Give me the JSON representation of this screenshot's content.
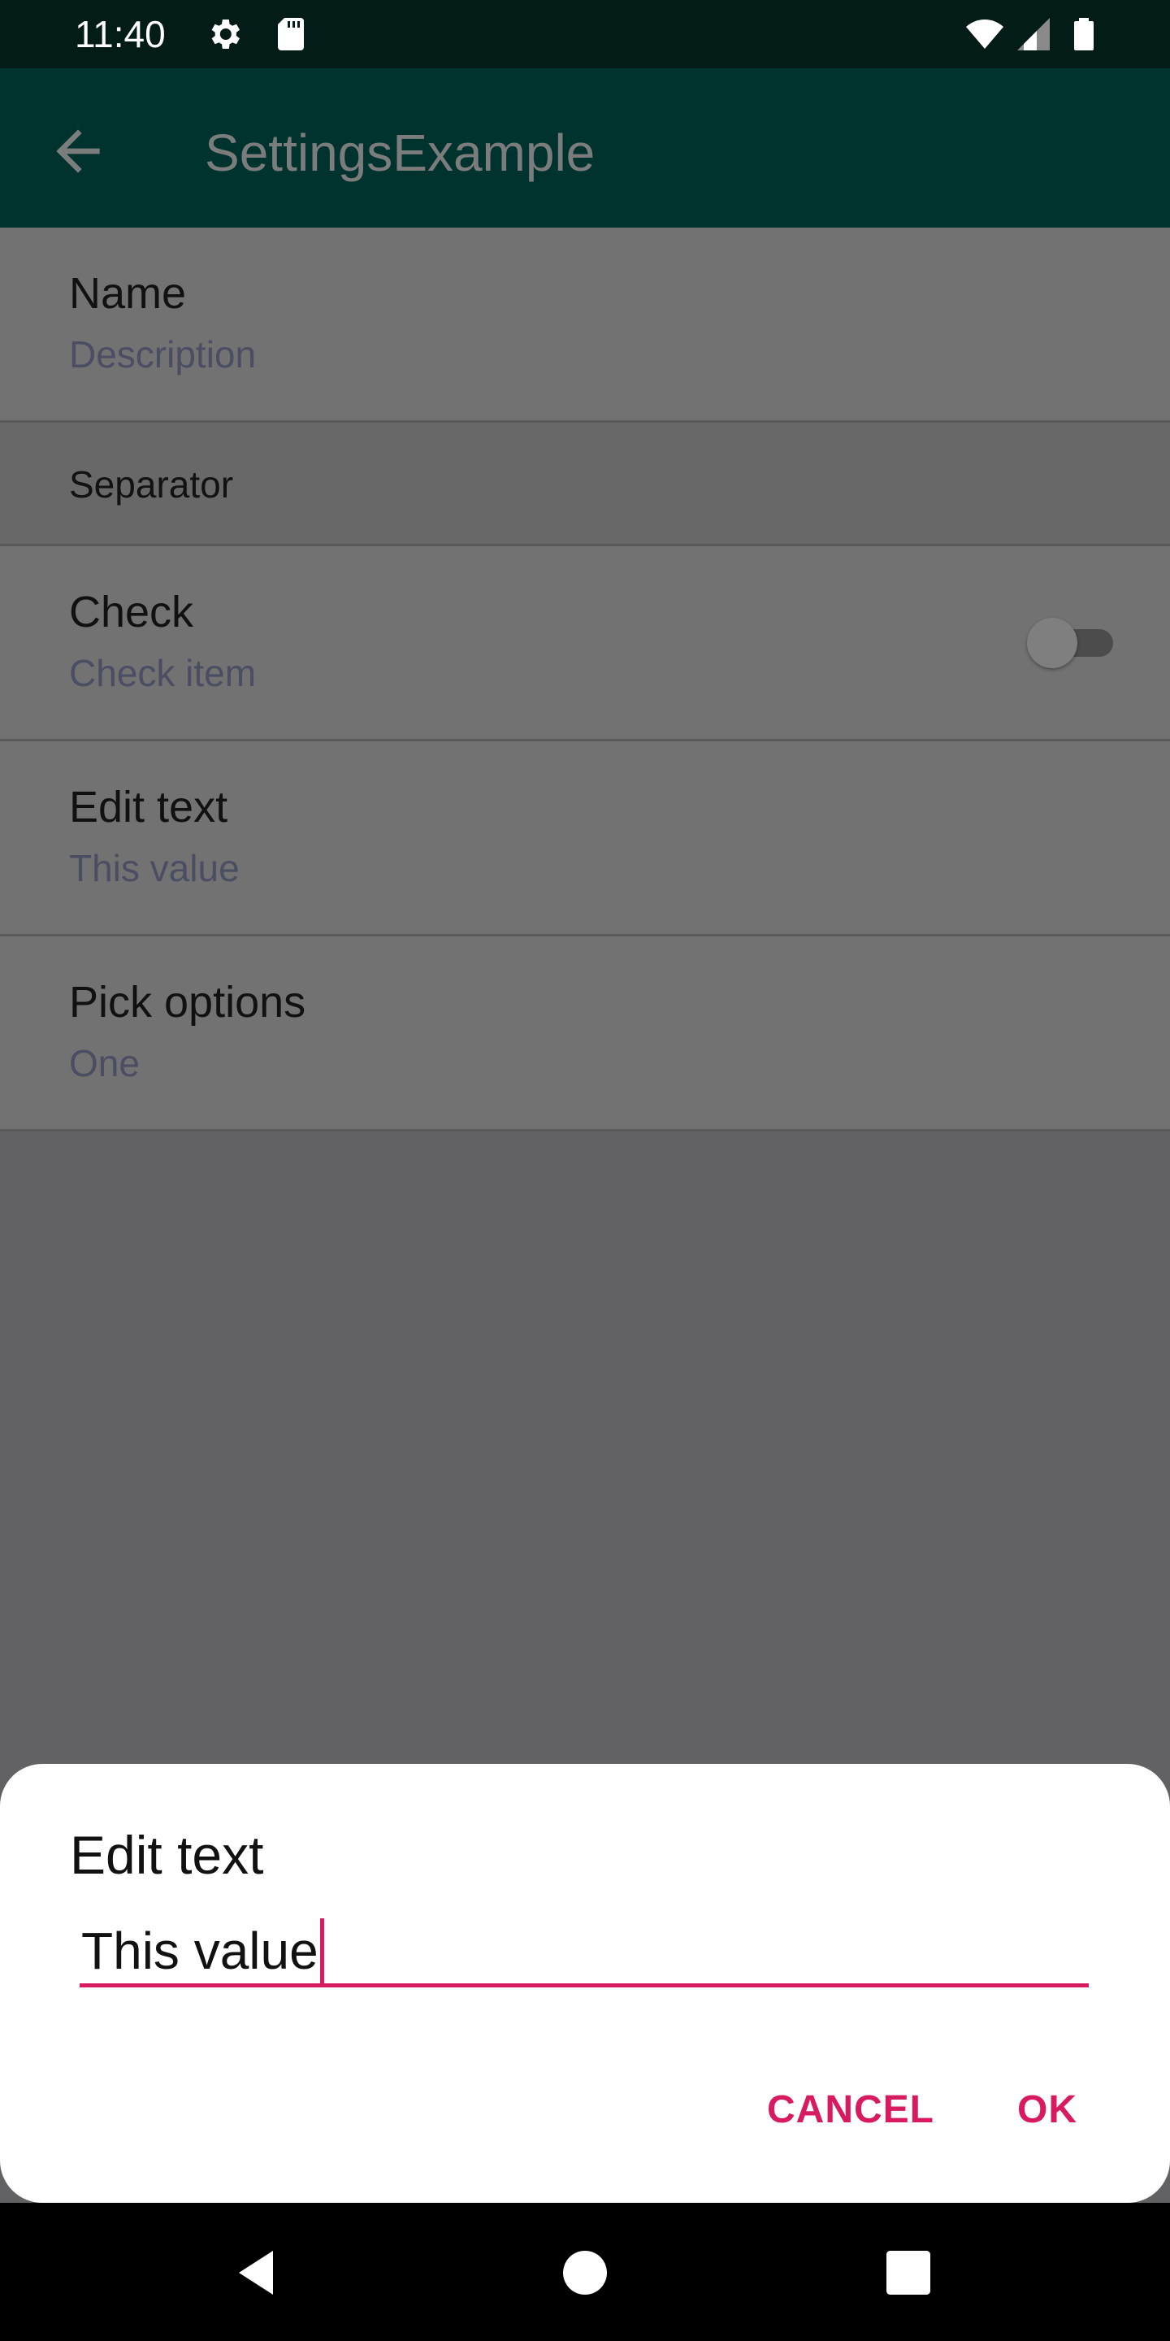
{
  "status_bar": {
    "time": "11:40",
    "left_icons": [
      "gear-icon",
      "sd-card-icon"
    ],
    "right_icons": [
      "wifi-icon",
      "signal-icon",
      "battery-icon"
    ],
    "background": "#031c18"
  },
  "app_bar": {
    "title": "SettingsExample",
    "nav_icon": "arrow-back-icon",
    "background": "#00332e"
  },
  "preferences": {
    "name": {
      "title": "Name",
      "summary": "Description"
    },
    "separator": {
      "title": "Separator"
    },
    "check": {
      "title": "Check",
      "summary": "Check item",
      "switch_on": false
    },
    "edit_text": {
      "title": "Edit text",
      "summary": "This value"
    },
    "pick_options": {
      "title": "Pick options",
      "summary": "One"
    }
  },
  "dialog": {
    "title": "Edit text",
    "input_value": "This value",
    "cancel_label": "CANCEL",
    "ok_label": "OK",
    "accent": "#d81b60"
  },
  "nav_bar": {
    "buttons": [
      "back-triangle-icon",
      "home-circle-icon",
      "recents-square-icon"
    ]
  }
}
